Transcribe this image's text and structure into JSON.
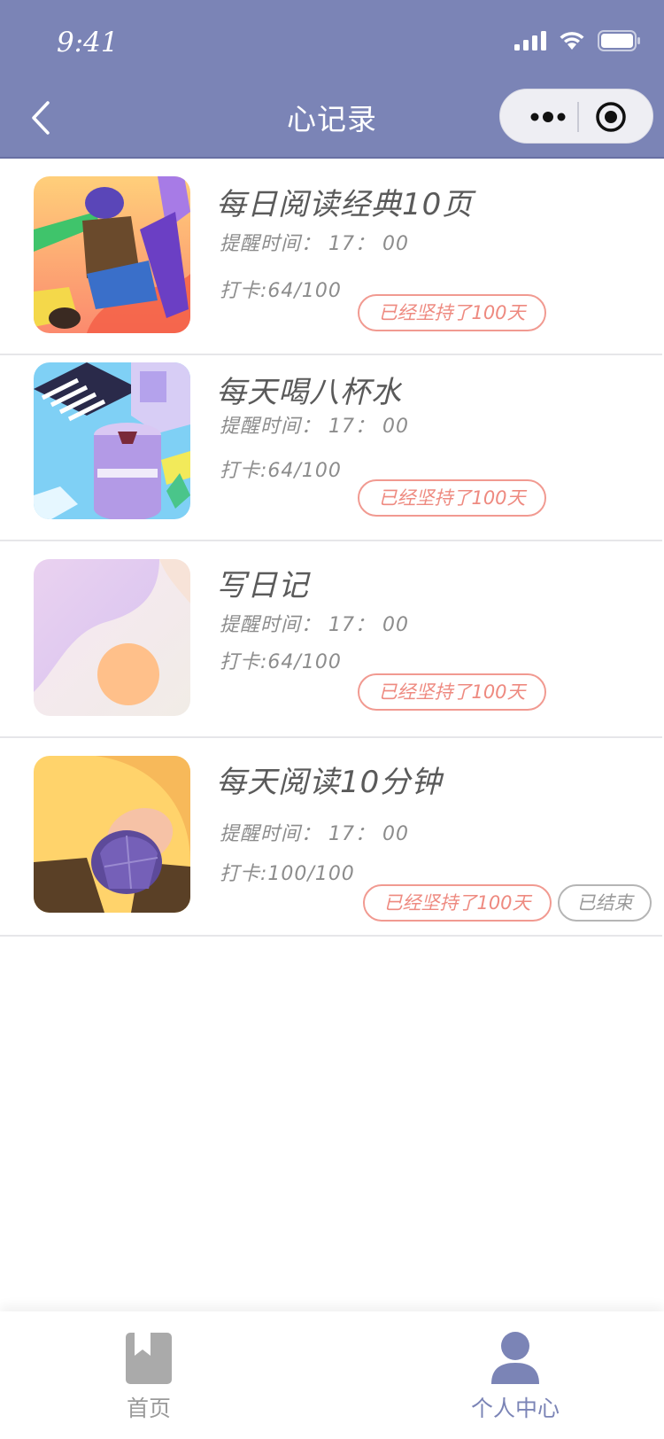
{
  "status_bar": {
    "time": "9:41"
  },
  "nav": {
    "title": "心记录"
  },
  "records": [
    {
      "title": "每日阅读经典10页",
      "remind": "提醒时间： 17： 00",
      "progress": "打卡:64/100",
      "badge": "已经坚持了100天",
      "image": "person-climbing-illustration"
    },
    {
      "title": "每天喝八杯水",
      "remind": "提醒时间： 17： 00",
      "progress": "打卡:64/100",
      "badge": "已经坚持了100天",
      "image": "isometric-city-illustration"
    },
    {
      "title": "写日记",
      "remind": "提醒时间： 17： 00",
      "progress": "打卡:64/100",
      "badge": "已经坚持了100天",
      "image": "abstract-sun-illustration"
    },
    {
      "title": "每天阅读10分钟",
      "remind": "提醒时间： 17： 00",
      "progress": "打卡:100/100",
      "badge": "已经坚持了100天",
      "status": "已结束",
      "image": "person-cap-topdown-illustration"
    }
  ],
  "tabbar": {
    "items": [
      {
        "label": "首页",
        "icon": "bookmark-book-icon",
        "active": false
      },
      {
        "label": "个人中心",
        "icon": "person-icon",
        "active": true
      }
    ]
  },
  "colors": {
    "header": "#7b84b6",
    "accent": "#7b84b6",
    "badge": "#ee8a80",
    "inactive": "#9a9a9a"
  }
}
